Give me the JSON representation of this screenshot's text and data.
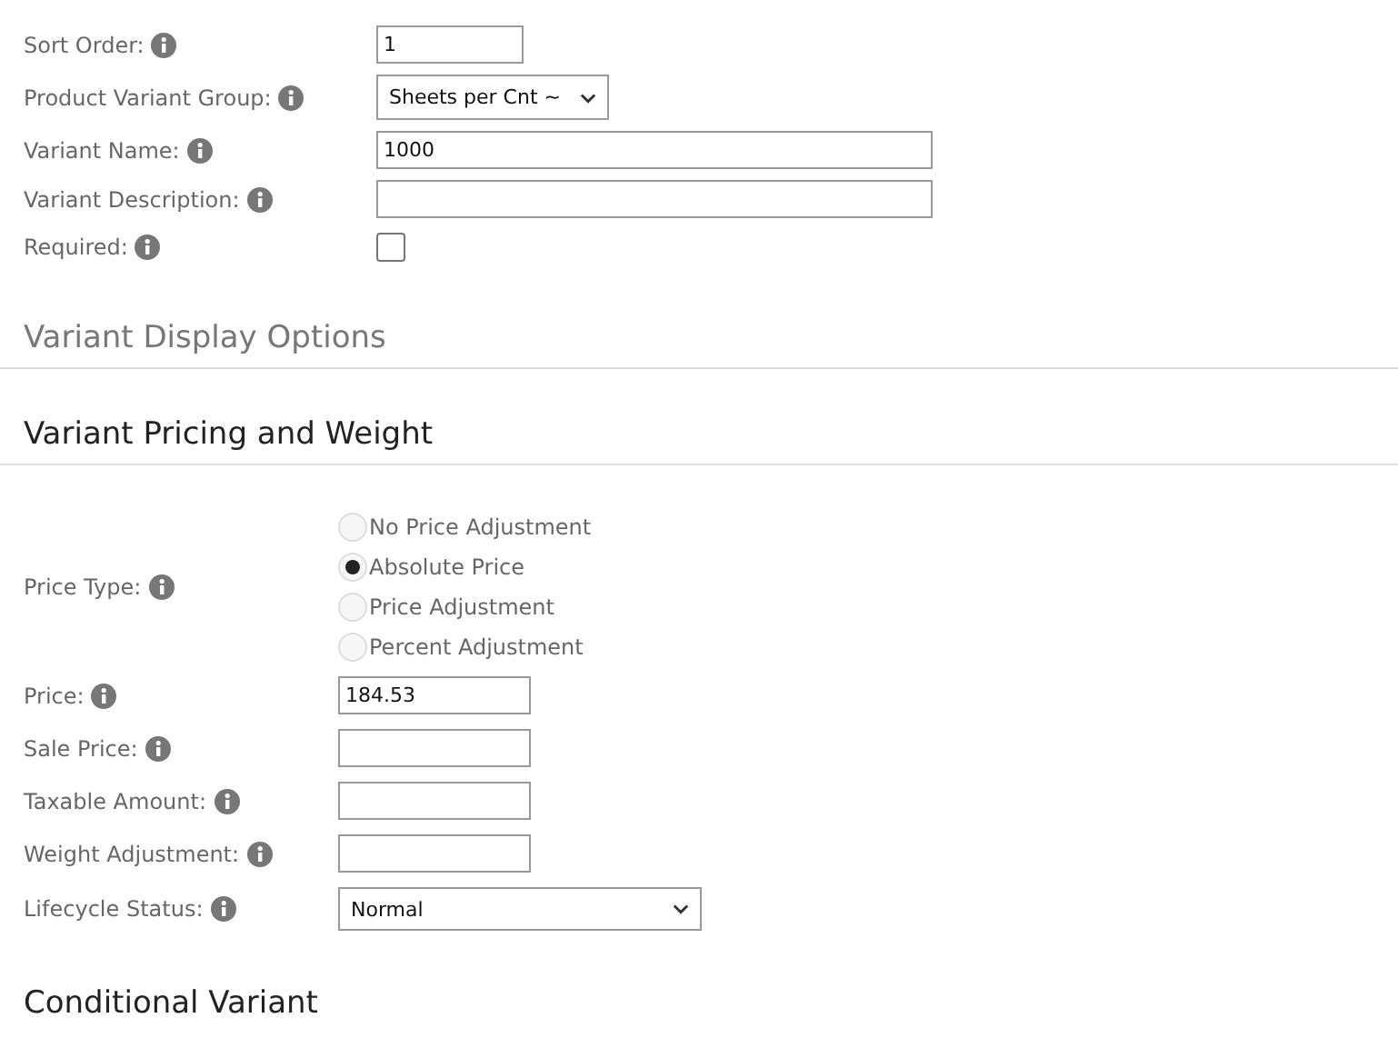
{
  "variant_fields": [
    {
      "kind": "short_text",
      "label": "Sort Order:",
      "value": "1"
    },
    {
      "kind": "select",
      "label": "Product Variant Group:",
      "value": "Sheets per Cnt ~"
    },
    {
      "kind": "text",
      "label": "Variant Name:",
      "value": "1000"
    },
    {
      "kind": "text",
      "label": "Variant Description:"
    },
    {
      "kind": "checkbox",
      "label": "Required:",
      "checked": false
    }
  ],
  "sections": [
    {
      "title": "Variant Display Options",
      "expanded": false
    },
    {
      "title": "Variant Pricing and Weight",
      "expanded": true
    }
  ],
  "price_type": {
    "label": "Price Type:",
    "options": [
      {
        "label": "No Price Adjustment",
        "selected": false
      },
      {
        "label": "Absolute Price",
        "selected": true
      },
      {
        "label": "Price Adjustment",
        "selected": false
      },
      {
        "label": "Percent Adjustment",
        "selected": false
      }
    ]
  },
  "pricing_fields": [
    {
      "kind": "text",
      "label": "Price:",
      "value": "184.53"
    },
    {
      "kind": "text",
      "label": "Sale Price:"
    },
    {
      "kind": "text",
      "label": "Taxable Amount:"
    },
    {
      "kind": "text",
      "label": "Weight Adjustment:"
    },
    {
      "kind": "select",
      "label": "Lifecycle Status:",
      "value": "Normal"
    }
  ],
  "next_section": {
    "title": "Conditional Variant"
  }
}
